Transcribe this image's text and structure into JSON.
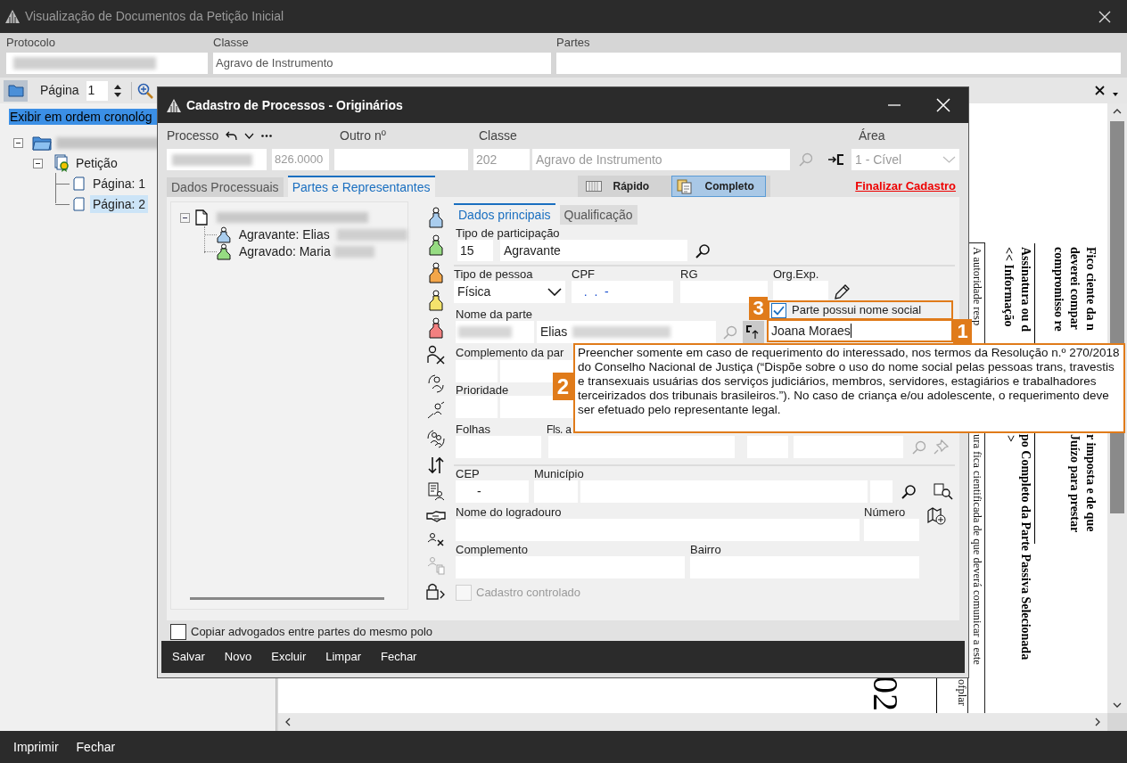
{
  "window": {
    "title": "Visualização de Documentos da Petição Inicial"
  },
  "header": {
    "protocolo": {
      "label": "Protocolo"
    },
    "classe": {
      "label": "Classe",
      "value": "Agravo de Instrumento"
    },
    "partes": {
      "label": "Partes"
    }
  },
  "toolbar": {
    "page_label": "Página",
    "page": "1"
  },
  "left_panel": {
    "order_option": "Exibir em ordem cronológ",
    "tree": {
      "expanded": true,
      "children": [
        {
          "label": "Petição",
          "expanded": true,
          "children": [
            {
              "label": "Página: 1",
              "selected": false
            },
            {
              "label": "Página: 2",
              "selected": true
            }
          ]
        }
      ]
    }
  },
  "document": {
    "lines": [
      {
        "text": "Fico ciente da n",
        "kind": "bold"
      },
      {
        "text": "r imposta e de que",
        "kind": "bold"
      },
      {
        "text": "deverei compar",
        "kind": "bold"
      },
      {
        "text": "Juízo para prestar",
        "kind": "bold"
      },
      {
        "text": "compromisso re",
        "kind": "bold"
      },
      {
        "text": "Assinatura ou d",
        "kind": "bold"
      },
      {
        "text": "po Completo da Parte Passiva Selecionada",
        "kind": "bold"
      },
      {
        "text": "<< Informação",
        "kind": "bold"
      },
      {
        "text": ">",
        "kind": "bold"
      },
      {
        "text": "A autoridade resp",
        "kind": "plain"
      },
      {
        "text": "ura fica cientificada de que deverá comunicar a este",
        "kind": "plain"
      },
      {
        "text": "ofplar",
        "kind": "plain"
      },
      {
        "text": "02",
        "kind": "large"
      }
    ]
  },
  "status_bar": {
    "buttons": [
      "Imprimir",
      "Fechar"
    ]
  },
  "dialog": {
    "title": "Cadastro de Processos - Originários",
    "processo": {
      "label": "Processo",
      "suffix": "826.0000",
      "disabled": true
    },
    "outro": {
      "label": "Outro nº"
    },
    "classe": {
      "label": "Classe",
      "code": "202",
      "name": "Agravo de Instrumento",
      "disabled": true
    },
    "area": {
      "label": "Área",
      "value": "1 - Cível",
      "disabled": true
    },
    "tabs": [
      {
        "label": "Dados Processuais",
        "selected": false
      },
      {
        "label": "Partes e Representantes",
        "selected": true
      }
    ],
    "modes": [
      {
        "label": "Rápido",
        "selected": false
      },
      {
        "label": "Completo",
        "selected": true
      }
    ],
    "finish_link": "Finalizar Cadastro",
    "parties": {
      "expanded": true,
      "children": [
        {
          "label": "Agravante: Elias",
          "color": "#a9cdee"
        },
        {
          "label": "Agravado: Maria",
          "color": "#96dc82"
        }
      ]
    },
    "subtabs": [
      {
        "label": "Dados principais",
        "selected": true
      },
      {
        "label": "Qualificação",
        "selected": false
      }
    ],
    "form": {
      "tipo_participacao": {
        "label": "Tipo de participação",
        "code": "15",
        "value": "Agravante"
      },
      "tipo_pessoa": {
        "label": "Tipo de pessoa",
        "value": "Física"
      },
      "cpf": {
        "label": "CPF",
        "value": "  .  .  -"
      },
      "rg": {
        "label": "RG"
      },
      "org_exp": {
        "label": "Org.Exp."
      },
      "nome": {
        "label": "Nome da parte",
        "value": "Elias"
      },
      "nome_social": {
        "label": "Parte possui nome social",
        "checked": true,
        "value": "Joana Moraes"
      },
      "complemento_parte": {
        "label": "Complemento da par"
      },
      "prioridade": {
        "label": "Prioridade"
      },
      "folhas": {
        "label": "Folhas"
      },
      "fls": {
        "label": "Fls. a"
      },
      "cep": {
        "label": "CEP",
        "value": "-"
      },
      "municipio": {
        "label": "Município"
      },
      "logradouro": {
        "label": "Nome do logradouro"
      },
      "numero": {
        "label": "Número"
      },
      "complemento": {
        "label": "Complemento"
      },
      "bairro": {
        "label": "Bairro"
      },
      "cadastro_controlado": {
        "label": "Cadastro controlado",
        "checked": false,
        "disabled": true
      }
    },
    "copy_lawyers": {
      "label": "Copiar advogados entre partes do mesmo polo",
      "checked": false
    },
    "buttons": [
      "Salvar",
      "Novo",
      "Excluir",
      "Limpar",
      "Fechar"
    ]
  },
  "callouts": {
    "field_badge": "1",
    "tooltip_badge": "2",
    "checkbox_badge": "3",
    "tooltip": "Preencher somente em caso de requerimento do interessado, nos termos da Resolução n.º 270/2018 do Conselho Nacional de Justiça (“Dispõe sobre o uso do nome social pelas pessoas trans, travestis e transexuais usuárias dos serviços judiciários, membros, servidores, estagiários e trabalhadores terceirizados dos tribunais brasileiros.”). No caso de criança e/ou adolescente, o requerimento deve ser efetuado pelo representante legal."
  }
}
